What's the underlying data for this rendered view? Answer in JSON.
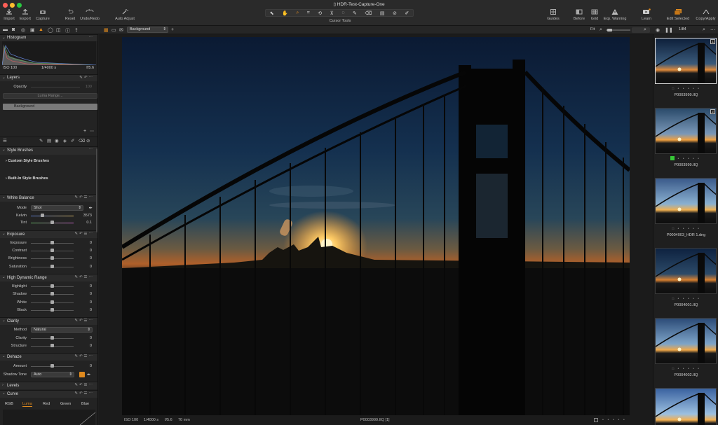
{
  "window": {
    "title": "HDR-Test-Capture-One"
  },
  "colors": {
    "accent": "#e08a1e",
    "panel": "#232323",
    "toolbar": "#2a2a2a",
    "color_tag": "#37c837"
  },
  "toolbar": {
    "import": "Import",
    "export": "Export",
    "capture": "Capture",
    "reset": "Reset",
    "undo_redo": "Undo/Redo",
    "auto_adjust": "Auto Adjust",
    "cursor_tools": "Cursor Tools",
    "guides": "Guides",
    "before": "Before",
    "grid": "Grid",
    "exp_warning": "Exp. Warning",
    "learn": "Learn",
    "edit_selected": "Edit Selected",
    "copy_apply": "Copy/Apply"
  },
  "subbar": {
    "layer_select": "Background",
    "fit": "Fit",
    "count": "1/84"
  },
  "histogram": {
    "title": "Histogram",
    "iso": "ISO 100",
    "shutter": "1/4000 s",
    "aperture": "f/5.6"
  },
  "layers": {
    "title": "Layers",
    "opacity_label": "Opacity",
    "opacity_value": "100",
    "luma_range": "Luma Range...",
    "background": "Background"
  },
  "style_brushes": {
    "title": "Style Brushes",
    "custom": "Custom Style Brushes",
    "builtin": "Built-In Style Brushes"
  },
  "white_balance": {
    "title": "White Balance",
    "mode_label": "Mode",
    "mode_value": "Shot",
    "kelvin_label": "Kelvin",
    "kelvin_value": "3573",
    "tint_label": "Tint",
    "tint_value": "0.1"
  },
  "exposure": {
    "title": "Exposure",
    "rows": [
      {
        "label": "Exposure",
        "value": "0"
      },
      {
        "label": "Contrast",
        "value": "0"
      },
      {
        "label": "Brightness",
        "value": "0"
      },
      {
        "label": "Saturation",
        "value": "0"
      }
    ]
  },
  "hdr": {
    "title": "High Dynamic Range",
    "rows": [
      {
        "label": "Highlight",
        "value": "0"
      },
      {
        "label": "Shadow",
        "value": "0"
      },
      {
        "label": "White",
        "value": "0"
      },
      {
        "label": "Black",
        "value": "0"
      }
    ]
  },
  "clarity": {
    "title": "Clarity",
    "method_label": "Method",
    "method_value": "Natural",
    "clarity_label": "Clarity",
    "clarity_value": "0",
    "structure_label": "Structure",
    "structure_value": "0"
  },
  "dehaze": {
    "title": "Dehaze",
    "amount_label": "Amount",
    "amount_value": "0",
    "shadow_tone_label": "Shadow Tone",
    "shadow_tone_value": "Auto"
  },
  "levels": {
    "title": "Levels"
  },
  "curve": {
    "title": "Curve",
    "tabs": [
      "RGB",
      "Luma",
      "Red",
      "Green",
      "Blue"
    ]
  },
  "status": {
    "iso": "ISO 100",
    "shutter": "1/4000 s",
    "aperture": "f/5.6",
    "focal": "70 mm",
    "file": "P0003999.IIQ [1]"
  },
  "filmstrip": [
    {
      "name": "P0003999.IIQ",
      "badge": "1",
      "selected": true
    },
    {
      "name": "P0003999.IIQ",
      "badge": "2",
      "selected": false
    },
    {
      "name": "P0004003_HDR 1.dng",
      "badge": "",
      "selected": false
    },
    {
      "name": "P0004001.IIQ",
      "badge": "",
      "selected": false
    },
    {
      "name": "P0004002.IIQ",
      "badge": "",
      "selected": false
    },
    {
      "name": "",
      "badge": "",
      "selected": false
    }
  ]
}
